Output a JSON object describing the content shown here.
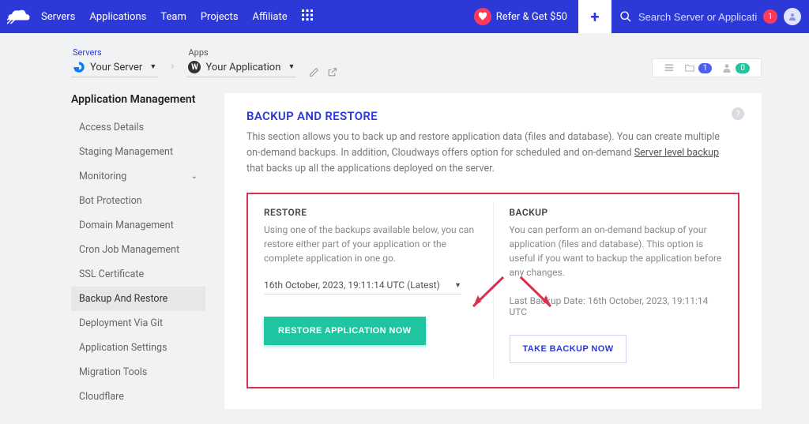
{
  "topnav": {
    "links": [
      "Servers",
      "Applications",
      "Team",
      "Projects",
      "Affiliate"
    ],
    "refer_label": "Refer & Get $50",
    "search_placeholder": "Search Server or Application",
    "notif_count": "1"
  },
  "breadcrumb": {
    "servers_label": "Servers",
    "server_name": "Your Server",
    "apps_label": "Apps",
    "app_name": "Your Application",
    "folder_badge": "1",
    "user_badge": "0"
  },
  "sidebar": {
    "title": "Application Management",
    "items": [
      {
        "label": "Access Details"
      },
      {
        "label": "Staging Management"
      },
      {
        "label": "Monitoring",
        "has_chevron": true
      },
      {
        "label": "Bot Protection"
      },
      {
        "label": "Domain Management"
      },
      {
        "label": "Cron Job Management"
      },
      {
        "label": "SSL Certificate"
      },
      {
        "label": "Backup And Restore",
        "active": true
      },
      {
        "label": "Deployment Via Git"
      },
      {
        "label": "Application Settings"
      },
      {
        "label": "Migration Tools"
      },
      {
        "label": "Cloudflare"
      }
    ]
  },
  "content": {
    "title": "BACKUP AND RESTORE",
    "desc_pre": "This section allows you to back up and restore application data (files and database). You can create multiple on-demand backups. In addition, Cloudways offers option for scheduled and on-demand ",
    "desc_link": "Server level backup",
    "desc_post": " that backs up all the applications deployed on the server.",
    "restore": {
      "title": "RESTORE",
      "desc": "Using one of the backups available below, you can restore either part of your application or the complete application in one go.",
      "selected": "16th October, 2023, 19:11:14 UTC (Latest)",
      "button": "RESTORE APPLICATION NOW"
    },
    "backup": {
      "title": "BACKUP",
      "desc": "You can perform an on-demand backup of your application (files and database). This option is useful if you want to backup the application before any changes.",
      "last_label": "Last Backup Date: 16th October, 2023, 19:11:14 UTC",
      "button": "TAKE BACKUP NOW"
    }
  }
}
